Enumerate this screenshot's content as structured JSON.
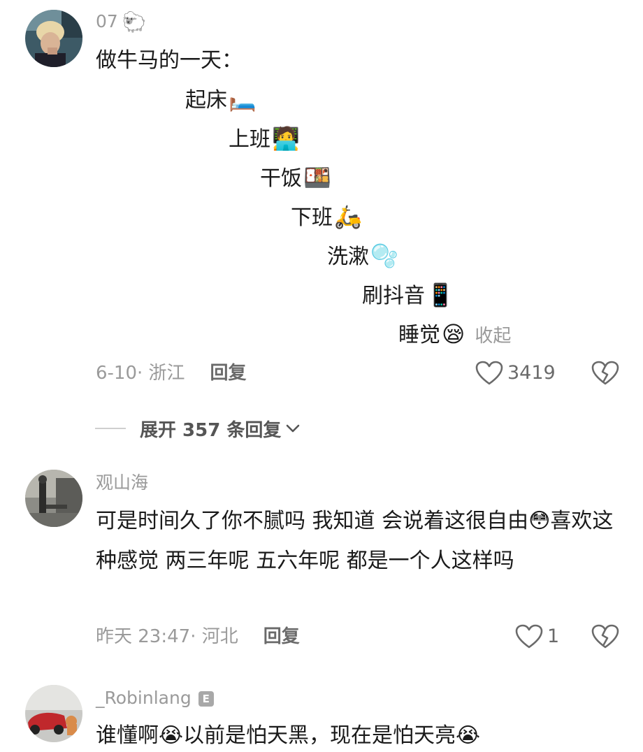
{
  "comments": [
    {
      "username": "07",
      "username_tag": "🐑",
      "intro": "做牛马的一天：",
      "steps": [
        {
          "text": "起床",
          "emoji": "🛏️"
        },
        {
          "text": "上班",
          "emoji": "🧑‍💻"
        },
        {
          "text": "干饭",
          "emoji": "🍱"
        },
        {
          "text": "下班",
          "emoji": "🛵"
        },
        {
          "text": "洗漱",
          "emoji": "🫧"
        },
        {
          "text": "刷抖音",
          "emoji": "📱"
        },
        {
          "text": "睡觉",
          "emoji": "😪"
        }
      ],
      "collapse_label": "收起",
      "meta": "6-10· 浙江",
      "reply_label": "回复",
      "likes": "3419",
      "expand_label": "展开 357 条回复"
    },
    {
      "username": "观山海",
      "text": "可是时间久了你不腻吗 我知道 会说着这很自由😳喜欢这种感觉 两三年呢 五六年呢 都是一个人这样吗",
      "meta": "昨天 23:47· 河北",
      "reply_label": "回复",
      "likes": "1"
    },
    {
      "username": "_Robinlang",
      "badge": "E",
      "text": "谁懂啊😭以前是怕天黑，现在是怕天亮😭"
    }
  ],
  "colors": {
    "text_primary": "#1a1a1a",
    "text_secondary": "#9a9a9a",
    "background": "#ffffff"
  }
}
